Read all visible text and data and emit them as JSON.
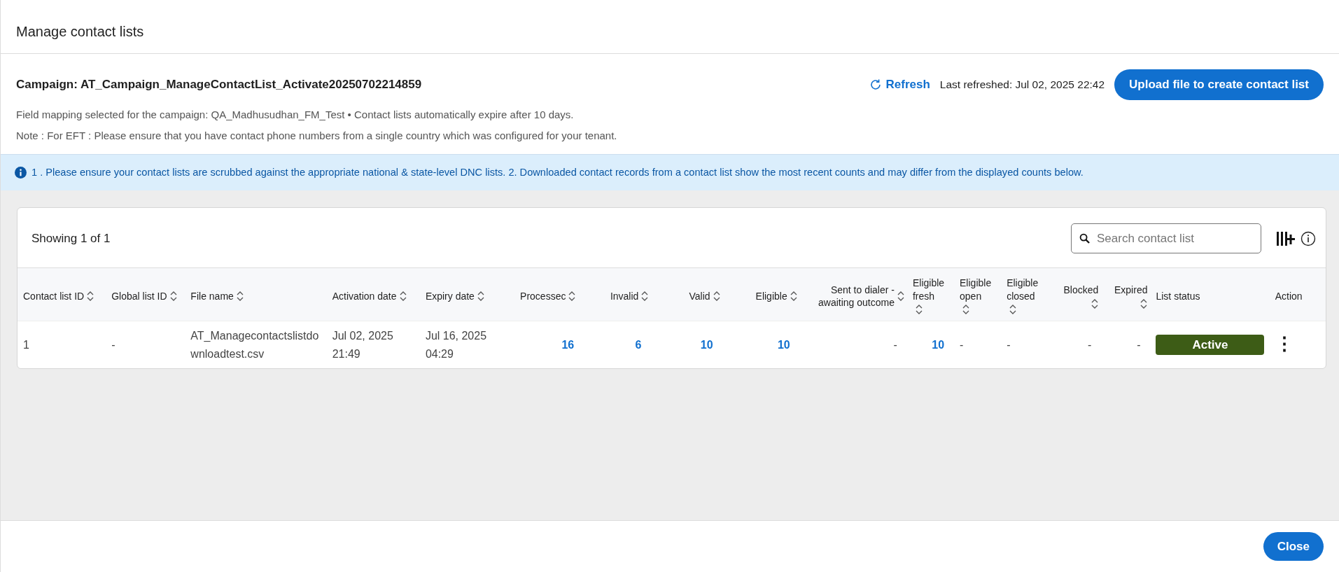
{
  "window": {
    "title": "Manage contact lists"
  },
  "campaign": {
    "title": "Campaign: AT_Campaign_ManageContactList_Activate20250702214859",
    "mapping": "Field mapping selected for the campaign: QA_Madhusudhan_FM_Test • Contact lists automatically expire after 10 days.",
    "note": "Note : For EFT : Please ensure that you have contact phone numbers from a single country which was configured for your tenant.",
    "refresh": "Refresh",
    "last_refreshed": "Last refreshed: Jul 02, 2025 22:42",
    "upload_button": "Upload file to create contact list"
  },
  "info_banner": "1 . Please ensure your contact lists are scrubbed against the appropriate national & state-level DNC lists. 2. Downloaded contact records from a contact list show the most recent counts and may differ from the displayed counts below.",
  "table": {
    "showing": "Showing 1 of 1",
    "search": {
      "placeholder": "Search contact list"
    },
    "columns": [
      {
        "label": "Contact list ID",
        "sortable": true
      },
      {
        "label": "Global list ID",
        "sortable": true
      },
      {
        "label": "File name",
        "sortable": true
      },
      {
        "label": "Activation date",
        "sortable": true
      },
      {
        "label": "Expiry date",
        "sortable": true
      },
      {
        "label": "Processec",
        "sortable": true
      },
      {
        "label": "Invalid",
        "sortable": true
      },
      {
        "label": "Valid",
        "sortable": true
      },
      {
        "label": "Eligible",
        "sortable": true
      },
      {
        "label": "Sent to dialer - awaiting outcome",
        "sortable": true
      },
      {
        "label": "Eligible fresh",
        "sortable": true
      },
      {
        "label": "Eligible open",
        "sortable": true
      },
      {
        "label": "Eligible closed",
        "sortable": true
      },
      {
        "label": "Blocked",
        "sortable": true
      },
      {
        "label": "Expired",
        "sortable": true
      },
      {
        "label": "List status",
        "sortable": false
      },
      {
        "label": "Action",
        "sortable": false
      }
    ],
    "rows": [
      {
        "cells": [
          {
            "kind": "text",
            "text": "1"
          },
          {
            "kind": "text",
            "text": "-"
          },
          {
            "kind": "text",
            "text": "AT_Managecontactslistdownloadtest.csv"
          },
          {
            "kind": "text",
            "text": "Jul 02, 2025 21:49"
          },
          {
            "kind": "text",
            "text": "Jul 16, 2025 04:29"
          },
          {
            "kind": "count",
            "text": "16"
          },
          {
            "kind": "count",
            "text": "6"
          },
          {
            "kind": "count",
            "text": "10"
          },
          {
            "kind": "count",
            "text": "10"
          },
          {
            "kind": "text",
            "text": "-"
          },
          {
            "kind": "count",
            "text": "10"
          },
          {
            "kind": "text",
            "text": "-"
          },
          {
            "kind": "text",
            "text": "-"
          },
          {
            "kind": "text",
            "text": "-"
          },
          {
            "kind": "text",
            "text": "-"
          },
          {
            "kind": "status",
            "text": "Active",
            "color": "#3d5c16"
          },
          {
            "kind": "menu",
            "text": "⋮"
          }
        ]
      }
    ]
  },
  "footer": {
    "close_button": "Close"
  }
}
